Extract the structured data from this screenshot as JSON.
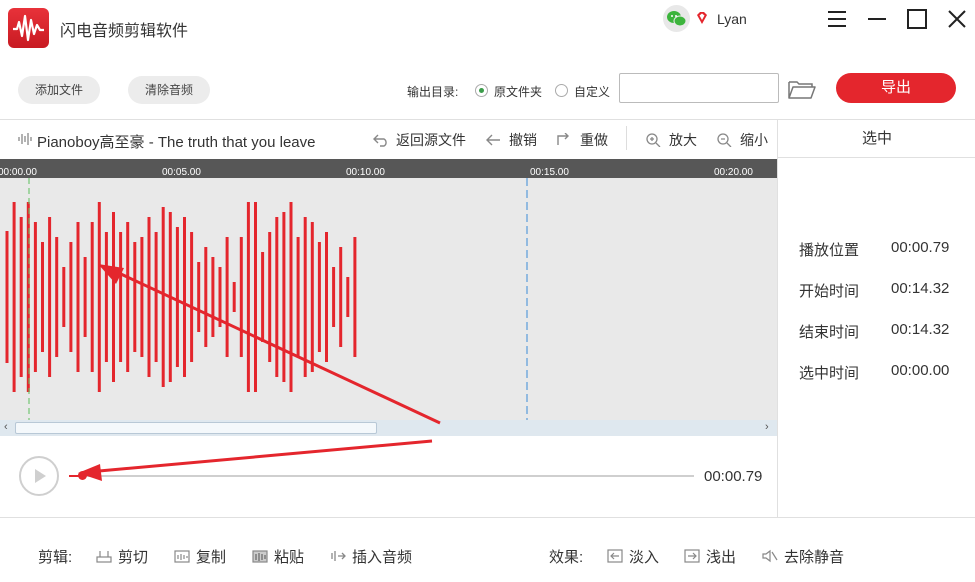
{
  "app": {
    "title": "闪电音频剪辑软件",
    "username": "Lyan",
    "accent": "#e4262d"
  },
  "toolbar": {
    "add_file_label": "添加文件",
    "clear_audio_label": "清除音频",
    "output_dir_label": "输出目录:",
    "radio_source_label": "原文件夹",
    "radio_custom_label": "自定义",
    "radio_selected": "原文件夹",
    "path_value": "",
    "export_label": "导出"
  },
  "editor": {
    "file_name": "Pianoboy高至豪 - The truth that you leave",
    "back_label": "返回源文件",
    "undo_label": "撤销",
    "redo_label": "重做",
    "zoom_in_label": "放大",
    "zoom_out_label": "缩小"
  },
  "timeline": {
    "ticks": [
      "00:00.00",
      "00:05.00",
      "00:10.00",
      "00:15.00",
      "00:20.00"
    ],
    "colors": {
      "waveform": "#e4262d",
      "playhead": "#5cc05c",
      "selection_marker": "#3a8ad6"
    }
  },
  "panel": {
    "title": "选中",
    "play_position_label": "播放位置",
    "play_position_value": "00:00.79",
    "start_time_label": "开始时间",
    "start_time_value": "00:14.32",
    "end_time_label": "结束时间",
    "end_time_value": "00:14.32",
    "selected_time_label": "选中时间",
    "selected_time_value": "00:00.00"
  },
  "player": {
    "time": "00:00.79",
    "progress_fraction": 0.017
  },
  "bottom": {
    "edit_label": "剪辑:",
    "cut_label": "剪切",
    "copy_label": "复制",
    "paste_label": "粘贴",
    "insert_audio_label": "插入音频",
    "effects_label": "效果:",
    "fade_in_label": "淡入",
    "fade_out_label": "浅出",
    "remove_silence_label": "去除静音"
  }
}
